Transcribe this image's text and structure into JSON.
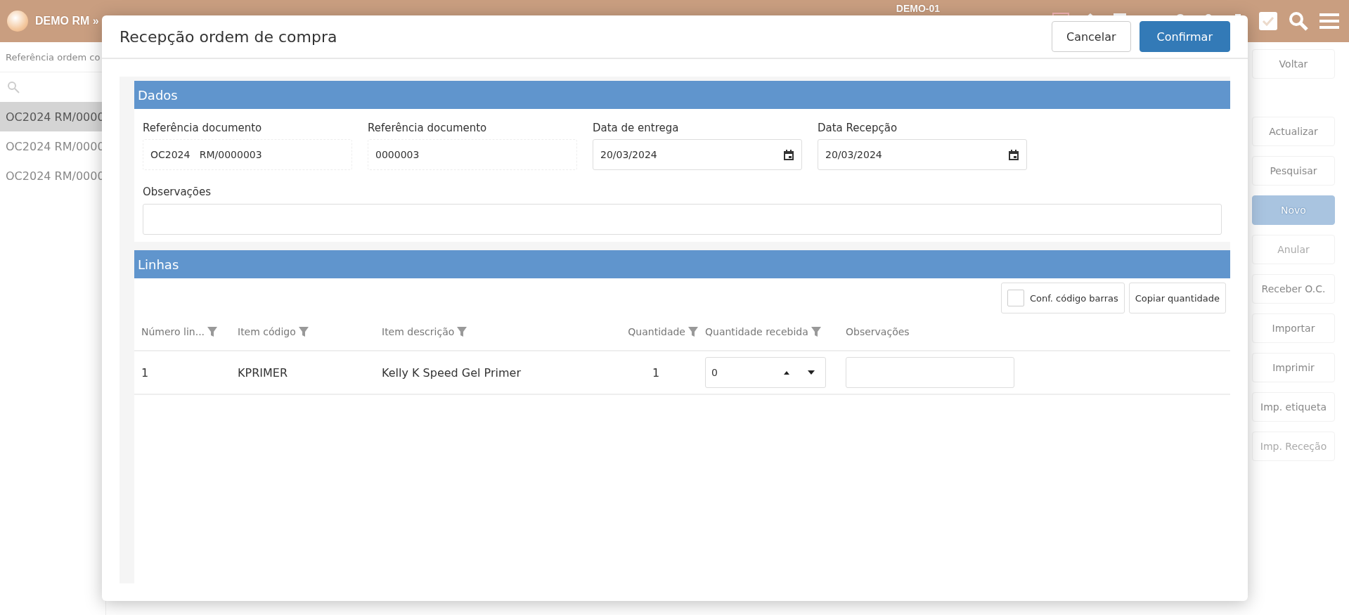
{
  "topbar": {
    "breadcrumb": "DEMO RM »",
    "workspace": "DEMO-01"
  },
  "list": {
    "placeholder": "Referência ordem co",
    "items": [
      {
        "label": "OC2024 RM/0000",
        "selected": true
      },
      {
        "label": "OC2024 RM/0000",
        "selected": false
      },
      {
        "label": "OC2024 RM/0000",
        "selected": false
      }
    ]
  },
  "actions": [
    {
      "label": "Voltar",
      "kind": "normal"
    },
    {
      "label": "Actualizar",
      "kind": "normal"
    },
    {
      "label": "Pesquisar",
      "kind": "normal"
    },
    {
      "label": "Novo",
      "kind": "primary"
    },
    {
      "label": "Anular",
      "kind": "disabled"
    },
    {
      "label": "Receber O.C.",
      "kind": "normal"
    },
    {
      "label": "Importar",
      "kind": "normal"
    },
    {
      "label": "Imprimir",
      "kind": "normal"
    },
    {
      "label": "Imp. etiqueta",
      "kind": "normal"
    },
    {
      "label": "Imp. Receção",
      "kind": "disabled"
    }
  ],
  "dialog": {
    "title": "Recepção ordem de compra",
    "buttons": [
      {
        "label": "Cancelar",
        "kind": "secondary"
      },
      {
        "label": "Confirmar",
        "kind": "primary"
      }
    ],
    "dados": {
      "title": "Dados",
      "fields": [
        {
          "label": "Referência documento",
          "value": "OC2024   RM/0000003",
          "kind": "readonly"
        },
        {
          "label": "Referência documento",
          "value": "0000003",
          "kind": "readonly"
        },
        {
          "label": "Data de entrega",
          "value": "20/03/2024",
          "kind": "date"
        },
        {
          "label": "Data Recepção",
          "value": "20/03/2024",
          "kind": "date"
        }
      ],
      "notes": {
        "label": "Observações"
      }
    },
    "linhas": {
      "title": "Linhas",
      "barcode": {
        "label": "Conf. código barras",
        "checked": false
      },
      "copy_button": "Copiar quantidade",
      "columns": [
        {
          "label": "Número lin...",
          "filter": true
        },
        {
          "label": "Item código",
          "filter": true
        },
        {
          "label": "Item descrição",
          "filter": true
        },
        {
          "label": "Quantidade",
          "filter": true
        },
        {
          "label": "Quantidade recebida",
          "filter": true
        },
        {
          "label": "Observações",
          "filter": false
        }
      ],
      "rows": [
        {
          "number": "1",
          "code": "KPRIMER",
          "description": "Kelly K Speed Gel Primer",
          "quantity": "1",
          "received": "0"
        }
      ]
    }
  }
}
